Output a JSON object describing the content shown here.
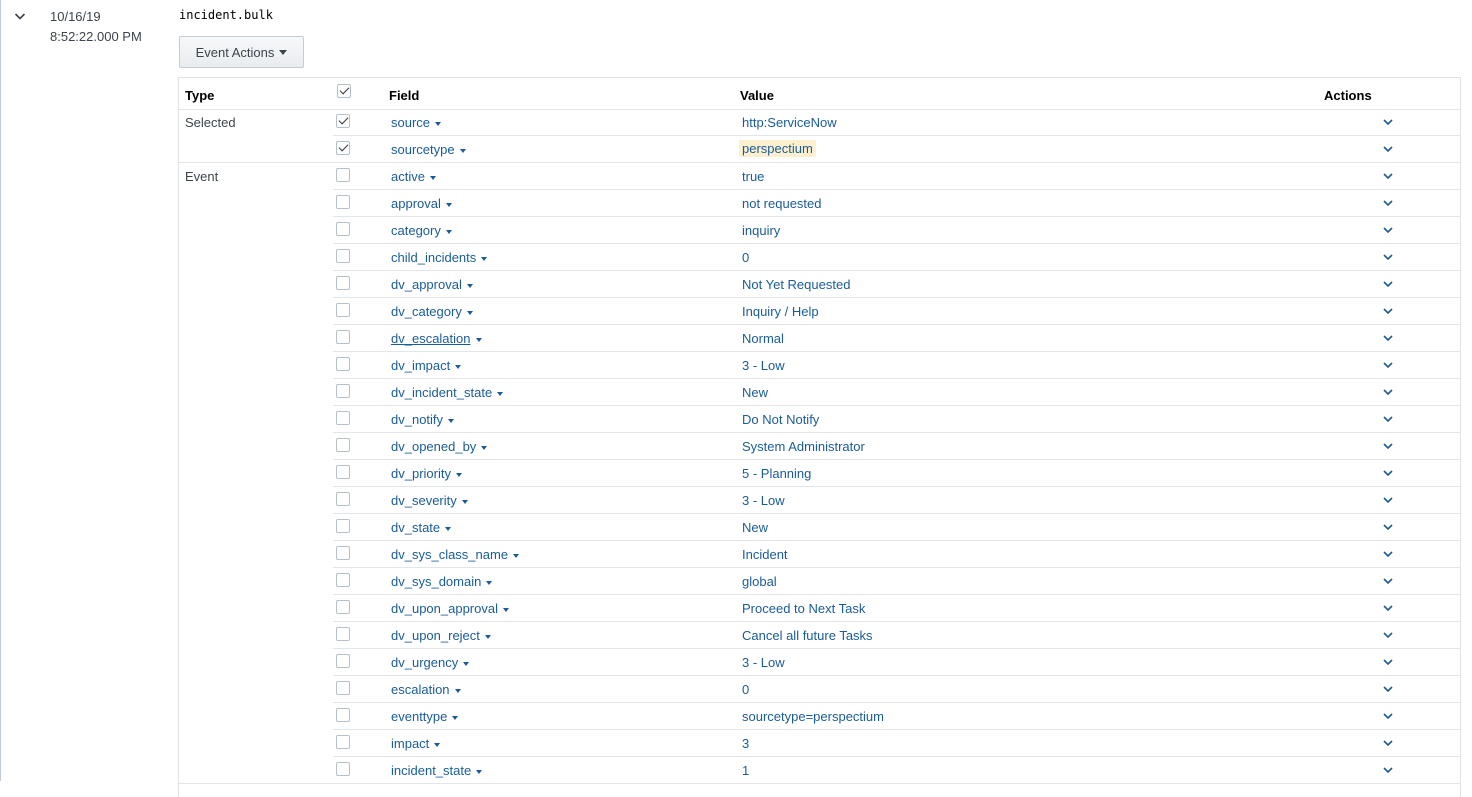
{
  "event": {
    "date": "10/16/19",
    "time": "8:52:22.000 PM",
    "raw": "incident.bulk",
    "actions_label": "Event Actions"
  },
  "table": {
    "headers": {
      "type": "Type",
      "field": "Field",
      "value": "Value",
      "actions": "Actions"
    },
    "groups": [
      {
        "label": "Selected",
        "rows": [
          {
            "field": "source",
            "value": "http:ServiceNow",
            "checked": true
          },
          {
            "field": "sourcetype",
            "value": "perspectium",
            "checked": true,
            "highlighted": true
          }
        ]
      },
      {
        "label": "Event",
        "rows": [
          {
            "field": "active",
            "value": "true",
            "checked": false
          },
          {
            "field": "approval",
            "value": "not requested",
            "checked": false
          },
          {
            "field": "category",
            "value": "inquiry",
            "checked": false
          },
          {
            "field": "child_incidents",
            "value": "0",
            "checked": false
          },
          {
            "field": "dv_approval",
            "value": "Not Yet Requested",
            "checked": false
          },
          {
            "field": "dv_category",
            "value": "Inquiry / Help",
            "checked": false
          },
          {
            "field": "dv_escalation",
            "value": "Normal",
            "checked": false,
            "hovered": true
          },
          {
            "field": "dv_impact",
            "value": "3 - Low",
            "checked": false
          },
          {
            "field": "dv_incident_state",
            "value": "New",
            "checked": false
          },
          {
            "field": "dv_notify",
            "value": "Do Not Notify",
            "checked": false
          },
          {
            "field": "dv_opened_by",
            "value": "System Administrator",
            "checked": false
          },
          {
            "field": "dv_priority",
            "value": "5 - Planning",
            "checked": false
          },
          {
            "field": "dv_severity",
            "value": "3 - Low",
            "checked": false
          },
          {
            "field": "dv_state",
            "value": "New",
            "checked": false
          },
          {
            "field": "dv_sys_class_name",
            "value": "Incident",
            "checked": false
          },
          {
            "field": "dv_sys_domain",
            "value": "global",
            "checked": false
          },
          {
            "field": "dv_upon_approval",
            "value": "Proceed to Next Task",
            "checked": false
          },
          {
            "field": "dv_upon_reject",
            "value": "Cancel all future Tasks",
            "checked": false
          },
          {
            "field": "dv_urgency",
            "value": "3 - Low",
            "checked": false
          },
          {
            "field": "escalation",
            "value": "0",
            "checked": false
          },
          {
            "field": "eventtype",
            "value": "sourcetype=perspectium",
            "checked": false
          },
          {
            "field": "impact",
            "value": "3",
            "checked": false
          },
          {
            "field": "incident_state",
            "value": "1",
            "checked": false
          }
        ]
      }
    ]
  },
  "icons": {
    "expander": "chevron-down-icon",
    "field_menu": "caret-down-icon",
    "row_action": "chevron-down-icon"
  },
  "colors": {
    "link": "#1a5c99",
    "highlight": "#fdf0cf",
    "border": "#e1e6eb"
  }
}
